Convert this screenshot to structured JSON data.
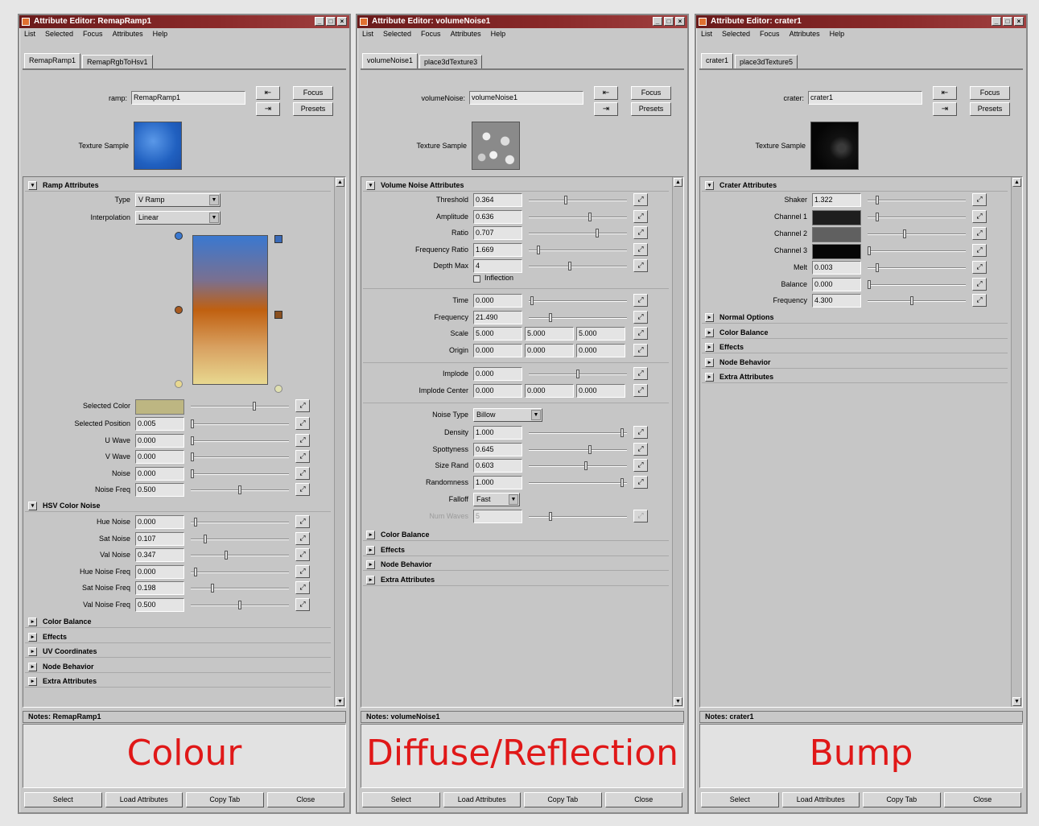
{
  "windows": [
    {
      "title": "Attribute Editor: RemapRamp1",
      "menu": [
        "List",
        "Selected",
        "Focus",
        "Attributes",
        "Help"
      ],
      "tabs": [
        "RemapRamp1",
        "RemapRgbToHsv1"
      ],
      "node_label": "ramp:",
      "node_value": "RemapRamp1",
      "focus": "Focus",
      "presets": "Presets",
      "texture_sample": "Texture Sample",
      "section": "Ramp Attributes",
      "type_label": "Type",
      "type_value": "V Ramp",
      "interp_label": "Interpolation",
      "interp_value": "Linear",
      "selected_color_label": "Selected Color",
      "rows": [
        {
          "label": "Selected Position",
          "value": "0.005"
        },
        {
          "label": "U Wave",
          "value": "0.000"
        },
        {
          "label": "V Wave",
          "value": "0.000"
        },
        {
          "label": "Noise",
          "value": "0.000"
        },
        {
          "label": "Noise Freq",
          "value": "0.500"
        }
      ],
      "hsv_section": "HSV Color Noise",
      "hsv_rows": [
        {
          "label": "Hue Noise",
          "value": "0.000"
        },
        {
          "label": "Sat Noise",
          "value": "0.107"
        },
        {
          "label": "Val Noise",
          "value": "0.347"
        },
        {
          "label": "Hue Noise Freq",
          "value": "0.000"
        },
        {
          "label": "Sat Noise Freq",
          "value": "0.198"
        },
        {
          "label": "Val Noise Freq",
          "value": "0.500"
        }
      ],
      "collapsed": [
        "Color Balance",
        "Effects",
        "UV Coordinates",
        "Node Behavior",
        "Extra Attributes"
      ],
      "notes": "Notes:  RemapRamp1",
      "caption": "Colour",
      "buttons": [
        "Select",
        "Load Attributes",
        "Copy Tab",
        "Close"
      ]
    },
    {
      "title": "Attribute Editor: volumeNoise1",
      "menu": [
        "List",
        "Selected",
        "Focus",
        "Attributes",
        "Help"
      ],
      "tabs": [
        "volumeNoise1",
        "place3dTexture3"
      ],
      "node_label": "volumeNoise:",
      "node_value": "volumeNoise1",
      "focus": "Focus",
      "presets": "Presets",
      "texture_sample": "Texture Sample",
      "section": "Volume Noise Attributes",
      "rows": [
        {
          "label": "Threshold",
          "value": "0.364"
        },
        {
          "label": "Amplitude",
          "value": "0.636"
        },
        {
          "label": "Ratio",
          "value": "0.707"
        },
        {
          "label": "Frequency Ratio",
          "value": "1.669"
        },
        {
          "label": "Depth Max",
          "value": "4"
        }
      ],
      "inflection": "Inflection",
      "rows2": [
        {
          "label": "Time",
          "value": "0.000"
        },
        {
          "label": "Frequency",
          "value": "21.490"
        }
      ],
      "scale_label": "Scale",
      "scale": [
        "5.000",
        "5.000",
        "5.000"
      ],
      "origin_label": "Origin",
      "origin": [
        "0.000",
        "0.000",
        "0.000"
      ],
      "implode_label": "Implode",
      "implode": "0.000",
      "implode_center_label": "Implode Center",
      "implode_center": [
        "0.000",
        "0.000",
        "0.000"
      ],
      "noise_type_label": "Noise Type",
      "noise_type": "Billow",
      "rows3": [
        {
          "label": "Density",
          "value": "1.000"
        },
        {
          "label": "Spottyness",
          "value": "0.645"
        },
        {
          "label": "Size Rand",
          "value": "0.603"
        },
        {
          "label": "Randomness",
          "value": "1.000"
        }
      ],
      "falloff_label": "Falloff",
      "falloff": "Fast",
      "num_waves_label": "Num Waves",
      "num_waves": "5",
      "collapsed": [
        "Color Balance",
        "Effects",
        "Node Behavior",
        "Extra Attributes"
      ],
      "notes": "Notes:  volumeNoise1",
      "caption": "Diffuse/Reflection",
      "buttons": [
        "Select",
        "Load Attributes",
        "Copy Tab",
        "Close"
      ]
    },
    {
      "title": "Attribute Editor: crater1",
      "menu": [
        "List",
        "Selected",
        "Focus",
        "Attributes",
        "Help"
      ],
      "tabs": [
        "crater1",
        "place3dTexture5"
      ],
      "node_label": "crater:",
      "node_value": "crater1",
      "focus": "Focus",
      "presets": "Presets",
      "texture_sample": "Texture Sample",
      "section": "Crater Attributes",
      "shaker_label": "Shaker",
      "shaker": "1.322",
      "channels": [
        "Channel 1",
        "Channel 2",
        "Channel 3"
      ],
      "rows": [
        {
          "label": "Melt",
          "value": "0.003"
        },
        {
          "label": "Balance",
          "value": "0.000"
        },
        {
          "label": "Frequency",
          "value": "4.300"
        }
      ],
      "collapsed": [
        "Normal Options",
        "Color Balance",
        "Effects",
        "Node Behavior",
        "Extra Attributes"
      ],
      "notes": "Notes:  crater1",
      "caption": "Bump",
      "buttons": [
        "Select",
        "Load Attributes",
        "Copy Tab",
        "Close"
      ]
    }
  ],
  "colors": {
    "ramp_top": "#3a78d0",
    "ramp_mid": "#c06010",
    "ramp_bottom": "#e8d890",
    "selected_color": "#bdb682",
    "sample_colour": "#2a6ad0",
    "caption": "#e01818"
  },
  "slider_levels": {
    "colour_selected_color": 0.65,
    "colour_rows": [
      0.02,
      0.02,
      0.02,
      0.02,
      0.5
    ],
    "colour_hsv": [
      0.05,
      0.15,
      0.36,
      0.05,
      0.22,
      0.5
    ],
    "diffuse_rows": [
      0.38,
      0.62,
      0.7,
      0.1,
      0.42
    ],
    "diffuse_rows2": [
      0.03,
      0.22
    ],
    "diffuse_implode": 0.5,
    "diffuse_rows3": [
      0.95,
      0.62,
      0.58,
      0.95
    ],
    "diffuse_num_waves": 0.22,
    "bump_shaker": 0.1,
    "bump_channels": [
      0.1,
      0.38,
      0.02
    ],
    "bump_rows": [
      0.1,
      0.02,
      0.45
    ]
  },
  "icons": [
    "input-connection-icon",
    "output-connection-icon",
    "map-button-icon",
    "expand-arrow-icon",
    "collapse-arrow-icon"
  ]
}
